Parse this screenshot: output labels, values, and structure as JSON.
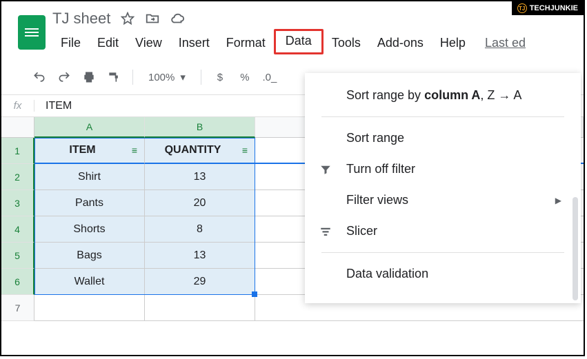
{
  "brand": "TECHJUNKIE",
  "doc": {
    "title": "TJ sheet"
  },
  "menubar": [
    "File",
    "Edit",
    "View",
    "Insert",
    "Format",
    "Data",
    "Tools",
    "Add-ons",
    "Help",
    "Last ed"
  ],
  "menubar_highlight_index": 5,
  "toolbar": {
    "zoom": "100%",
    "currency": "$",
    "percent": "%"
  },
  "formula_bar": {
    "label": "fx",
    "value": "ITEM"
  },
  "columns": [
    "A",
    "B"
  ],
  "table": {
    "headers": [
      "ITEM",
      "QUANTITY"
    ],
    "rows": [
      [
        "Shirt",
        "13"
      ],
      [
        "Pants",
        "20"
      ],
      [
        "Shorts",
        "8"
      ],
      [
        "Bags",
        "13"
      ],
      [
        "Wallet",
        "29"
      ]
    ]
  },
  "dropdown": {
    "sort_range_by_prefix": "Sort range by ",
    "sort_range_by_bold": "column A",
    "sort_range_by_suffix": ", Z → A",
    "sort_range": "Sort range",
    "turn_off_filter": "Turn off filter",
    "filter_views": "Filter views",
    "slicer": "Slicer",
    "data_validation": "Data validation"
  }
}
